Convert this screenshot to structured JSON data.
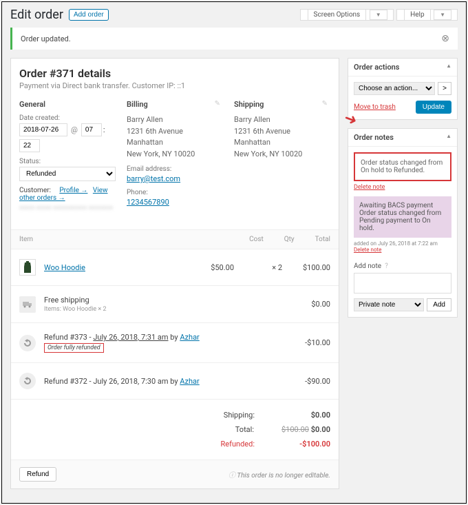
{
  "header": {
    "title": "Edit order",
    "add_btn": "Add order",
    "screen_options": "Screen Options",
    "help": "Help"
  },
  "notice": {
    "text": "Order updated."
  },
  "order": {
    "title": "Order #371 details",
    "subtitle": "Payment via Direct bank transfer. Customer IP: ::1",
    "general_heading": "General",
    "billing_heading": "Billing",
    "shipping_heading": "Shipping",
    "date_label": "Date created:",
    "date_value": "2018-07-26",
    "hour_value": "07",
    "minute_value": "22",
    "status_label": "Status:",
    "status_value": "Refunded",
    "customer_label": "Customer:",
    "profile_link": "Profile →",
    "other_orders_link": "View other orders →",
    "billing_addr": {
      "name": "Barry Allen",
      "street": "1231 6th Avenue",
      "city": "Manhattan",
      "region": "New York, NY 10020"
    },
    "email_label": "Email address:",
    "email": "barry@test.com",
    "phone_label": "Phone:",
    "phone": "1234567890",
    "shipping_addr": {
      "name": "Barry Allen",
      "street": "1231 6th Avenue",
      "city": "Manhattan",
      "region": "New York, NY 10020"
    }
  },
  "items": {
    "head_item": "Item",
    "head_cost": "Cost",
    "head_qty": "Qty",
    "head_total": "Total",
    "product": {
      "name": "Woo Hoodie",
      "cost": "$50.00",
      "qty": "× 2",
      "total": "$100.00"
    },
    "shipping": {
      "name": "Free shipping",
      "meta": "Items: Woo Hoodie × 2",
      "total": "$0.00"
    },
    "refund1": {
      "text_a": "Refund #373 - ",
      "text_b": "July 26, 2018, 7:31 am",
      "by": " by ",
      "author": "Azhar",
      "label": "Order fully refunded",
      "amount": "-$10.00"
    },
    "refund2": {
      "text_a": "Refund #372 - July 26, 2018, 7:30 am by ",
      "author": "Azhar",
      "amount": "-$90.00"
    }
  },
  "totals": {
    "shipping_label": "Shipping:",
    "shipping_value": "$0.00",
    "total_label": "Total:",
    "total_strike": "$100.00",
    "total_value": "$0.00",
    "refunded_label": "Refunded:",
    "refunded_value": "-$100.00"
  },
  "footer": {
    "refund_btn": "Refund",
    "no_edit": "This order is no longer editable."
  },
  "actions": {
    "heading": "Order actions",
    "placeholder": "Choose an action...",
    "trash": "Move to trash",
    "update": "Update"
  },
  "notes": {
    "heading": "Order notes",
    "note1_text": "Order status changed from On hold to Refunded.",
    "note1_delete": "Delete note",
    "note2_text": "Awaiting BACS payment Order status changed from Pending payment to On hold.",
    "note2_meta": "added on July 26, 2018 at 7:22 am",
    "note2_delete": "Delete note",
    "add_label": "Add note",
    "type": "Private note",
    "add_btn": "Add"
  }
}
